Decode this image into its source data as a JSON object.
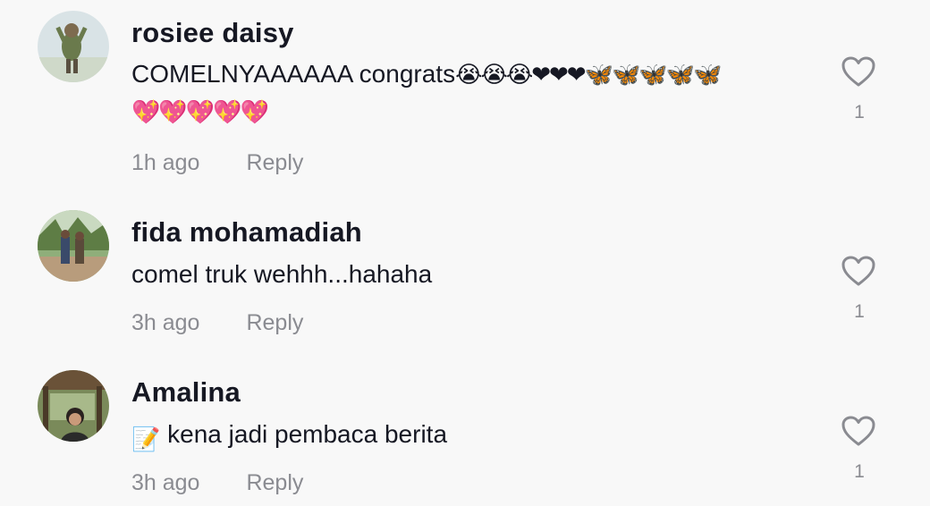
{
  "comments": [
    {
      "username": "rosiee daisy",
      "text_line1": "COMELNYAAAAAA congrats",
      "emoji_line1": "😭😭😭❤❤❤🦋🦋🦋🦋🦋",
      "emoji_line2": "💖💖💖💖💖",
      "time": "1h ago",
      "reply_label": "Reply",
      "likes": "1"
    },
    {
      "username": "fida mohamadiah",
      "text_line1": "comel truk wehhh...hahaha",
      "time": "3h ago",
      "reply_label": "Reply",
      "likes": "1"
    },
    {
      "username": "Amalina",
      "emoji_prefix": "📝",
      "text_line1": "kena jadi pembaca berita",
      "time": "3h ago",
      "reply_label": "Reply",
      "likes": "1"
    }
  ],
  "icons": {
    "like": "heart-outline-icon"
  },
  "colors": {
    "background": "#f8f8f8",
    "username": "#161823",
    "secondary": "#8a8b91"
  }
}
